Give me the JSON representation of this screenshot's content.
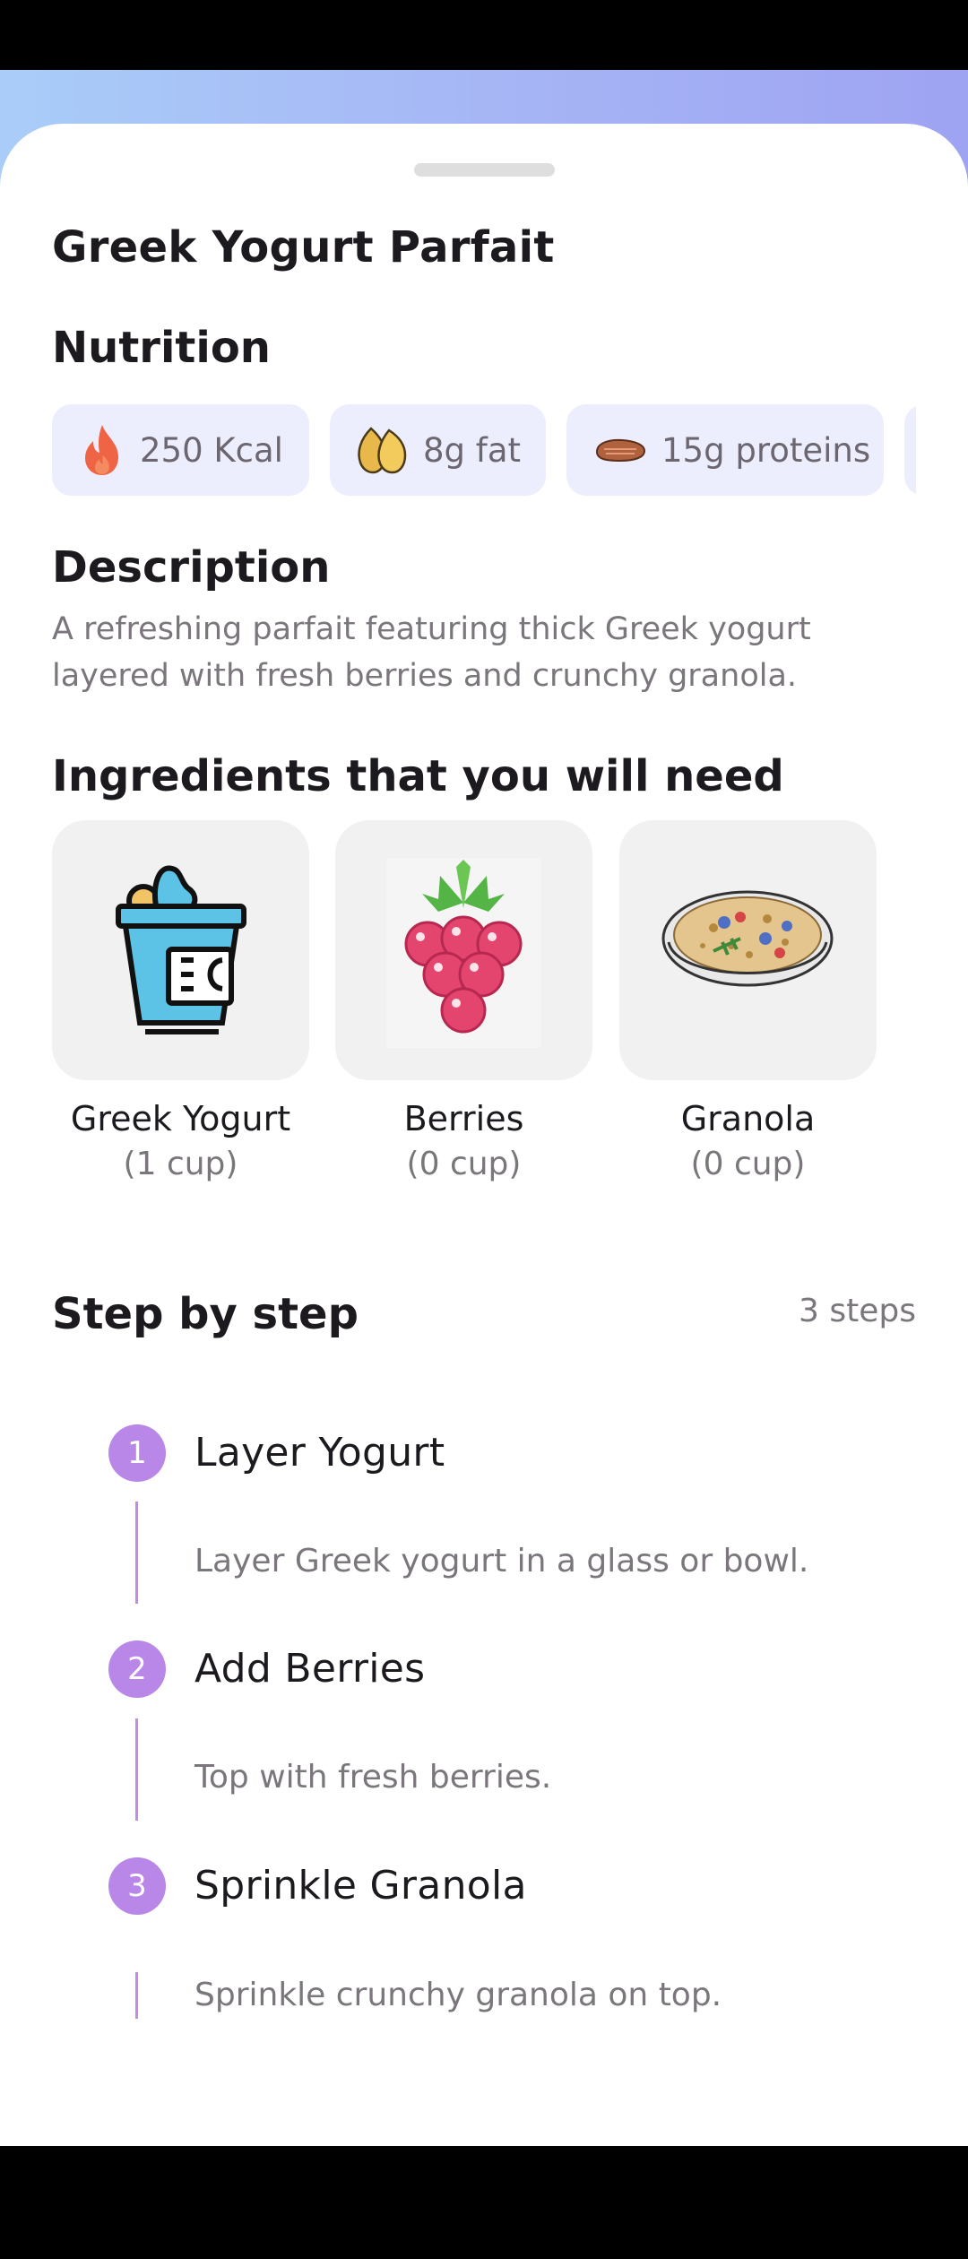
{
  "recipe": {
    "title": "Greek Yogurt Parfait",
    "nutrition_heading": "Nutrition",
    "nutrition": [
      {
        "icon": "flame-icon",
        "label": "250 Kcal"
      },
      {
        "icon": "almond-icon",
        "label": "8g fat"
      },
      {
        "icon": "steak-icon",
        "label": "15g proteins"
      }
    ],
    "description_heading": "Description",
    "description": "A refreshing parfait featuring thick Greek yogurt layered with fresh berries and crunchy granola.",
    "ingredients_heading": "Ingredients that you will need",
    "ingredients": [
      {
        "name": "Greek Yogurt",
        "qty": "(1 cup)",
        "icon": "yogurt-cup-icon"
      },
      {
        "name": "Berries",
        "qty": "(0 cup)",
        "icon": "berries-icon"
      },
      {
        "name": "Granola",
        "qty": "(0 cup)",
        "icon": "granola-bowl-icon"
      }
    ],
    "steps_heading": "Step by step",
    "steps_count": "3 steps",
    "steps": [
      {
        "number": "1",
        "title": "Layer Yogurt",
        "text": "Layer Greek yogurt in a glass or bowl."
      },
      {
        "number": "2",
        "title": "Add Berries",
        "text": "Top with fresh berries."
      },
      {
        "number": "3",
        "title": "Sprinkle Granola",
        "text": "Sprinkle crunchy granola on top."
      }
    ]
  },
  "colors": {
    "accent": "#b887e8",
    "chip_background": "#eceefd",
    "card_background": "#f1f1f1",
    "gradient_start": "#a9cdf8",
    "gradient_end": "#9ea3f2"
  }
}
